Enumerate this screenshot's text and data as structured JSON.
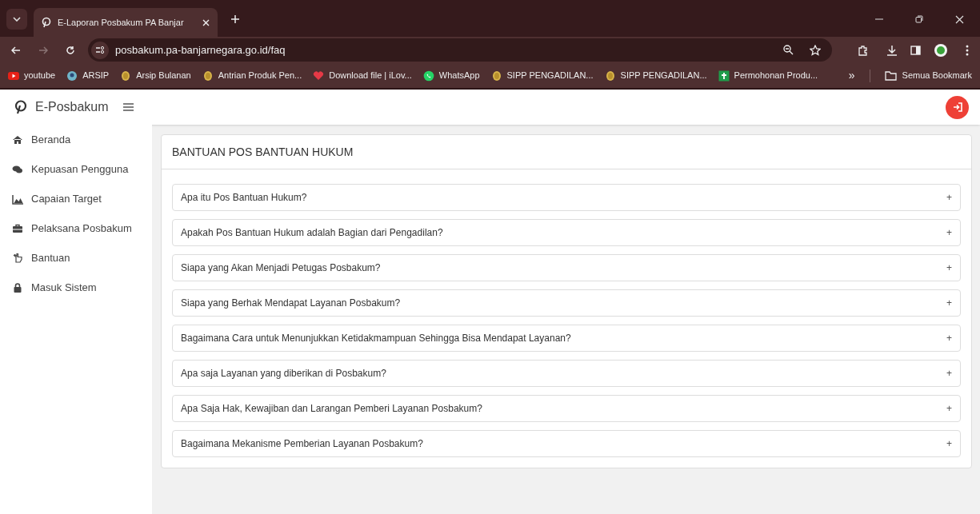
{
  "browser": {
    "tab_title": "E-Laporan Posbakum PA Banjar",
    "url": "posbakum.pa-banjarnegara.go.id/faq",
    "bookmarks": [
      {
        "kind": "youtube",
        "label": "youtube"
      },
      {
        "kind": "globe",
        "label": "ARSIP"
      },
      {
        "kind": "coin",
        "label": "Arsip Bulanan"
      },
      {
        "kind": "coin",
        "label": "Antrian Produk Pen..."
      },
      {
        "kind": "heart",
        "label": "Download file | iLov..."
      },
      {
        "kind": "whatsapp",
        "label": "WhatsApp"
      },
      {
        "kind": "coin",
        "label": "SIPP PENGADILAN..."
      },
      {
        "kind": "coin",
        "label": "SIPP PENGADILAN..."
      },
      {
        "kind": "sheet",
        "label": "Permohonan Produ..."
      }
    ],
    "more": "»",
    "all_bookmarks": "Semua Bookmark"
  },
  "app": {
    "brand": "E-Posbakum"
  },
  "sidebar": {
    "items": [
      {
        "kind": "home",
        "label": "Beranda"
      },
      {
        "kind": "chat",
        "label": "Kepuasan Pengguna"
      },
      {
        "kind": "chart",
        "label": "Capaian Target"
      },
      {
        "kind": "briefcase",
        "label": "Pelaksana Posbakum"
      },
      {
        "kind": "hand",
        "label": "Bantuan"
      },
      {
        "kind": "lock",
        "label": "Masuk Sistem"
      }
    ]
  },
  "card": {
    "title": "BANTUAN POS BANTUAN HUKUM",
    "faq": [
      {
        "question": "Apa itu Pos Bantuan Hukum?",
        "toggle": "+"
      },
      {
        "question": "Apakah Pos Bantuan Hukum adalah Bagian dari Pengadilan?",
        "toggle": "+"
      },
      {
        "question": "Siapa yang Akan Menjadi Petugas Posbakum?",
        "toggle": "+"
      },
      {
        "question": "Siapa yang Berhak Mendapat Layanan Posbakum?",
        "toggle": "+"
      },
      {
        "question": "Bagaimana Cara untuk Menunjukkan Ketidakmampuan Sehingga Bisa Mendapat Layanan?",
        "toggle": "+"
      },
      {
        "question": "Apa saja Layanan yang diberikan di Posbakum?",
        "toggle": "+"
      },
      {
        "question": "Apa Saja Hak, Kewajiban dan Larangan Pemberi Layanan Posbakum?",
        "toggle": "+"
      },
      {
        "question": "Bagaimana Mekanisme Pemberian Layanan Posbakum?",
        "toggle": "+"
      }
    ]
  }
}
